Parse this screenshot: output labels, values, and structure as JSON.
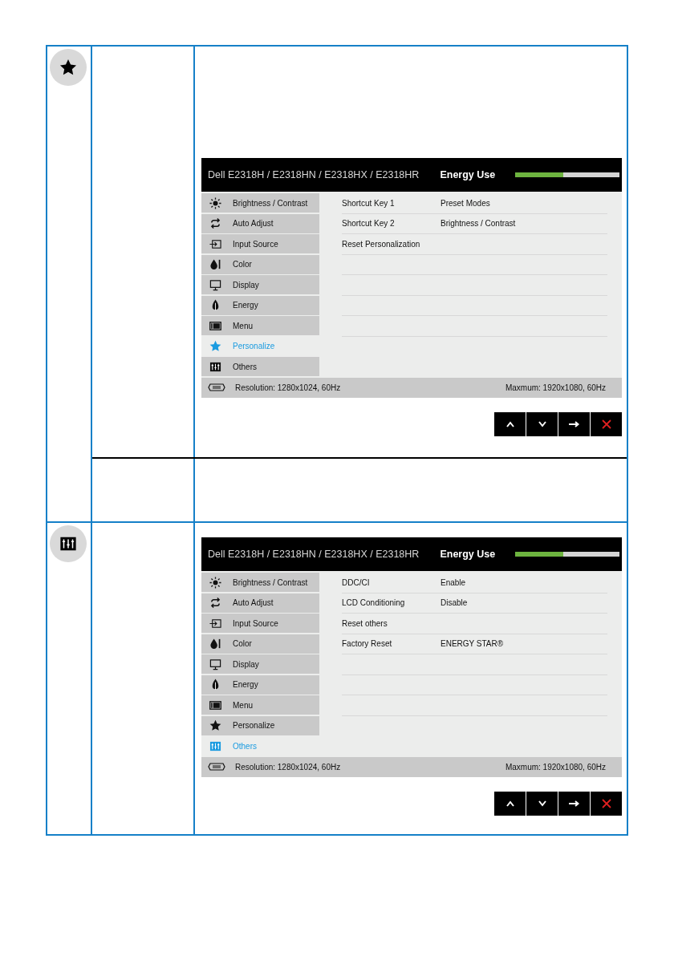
{
  "sections": [
    {
      "kind": "personalize",
      "osd": {
        "title": "Dell E2318H / E2318HN / E2318HX / E2318HR",
        "energy_label": "Energy Use",
        "energy": {
          "level": 0.46
        },
        "menu": [
          {
            "label": "Brightness / Contrast",
            "kind": "brightness",
            "selected": false
          },
          {
            "label": "Auto Adjust",
            "kind": "auto-adjust",
            "selected": false
          },
          {
            "label": "Input Source",
            "kind": "input",
            "selected": false
          },
          {
            "label": "Color",
            "kind": "color",
            "selected": false
          },
          {
            "label": "Display",
            "kind": "display",
            "selected": false
          },
          {
            "label": "Energy",
            "kind": "energy",
            "selected": false
          },
          {
            "label": "Menu",
            "kind": "menu",
            "selected": false
          },
          {
            "label": "Personalize",
            "kind": "personalize",
            "selected": true
          },
          {
            "label": "Others",
            "kind": "others",
            "selected": false
          }
        ],
        "settings": [
          {
            "label": "Shortcut Key 1",
            "value": "Preset Modes"
          },
          {
            "label": "Shortcut Key 2",
            "value": "Brightness / Contrast"
          },
          {
            "label": "Reset Personalization"
          }
        ],
        "resolution": "Resolution: 1280x1024, 60Hz",
        "maximum": "Maxmum: 1920x1080, 60Hz",
        "buttons": [
          {
            "kind": "up"
          },
          {
            "kind": "down"
          },
          {
            "kind": "right"
          },
          {
            "kind": "close"
          }
        ]
      }
    },
    {
      "kind": "others",
      "osd": {
        "title": "Dell E2318H / E2318HN / E2318HX / E2318HR",
        "energy_label": "Energy Use",
        "energy": {
          "level": 0.46
        },
        "menu": [
          {
            "label": "Brightness / Contrast",
            "kind": "brightness",
            "selected": false
          },
          {
            "label": "Auto Adjust",
            "kind": "auto-adjust",
            "selected": false
          },
          {
            "label": "Input Source",
            "kind": "input",
            "selected": false
          },
          {
            "label": "Color",
            "kind": "color",
            "selected": false
          },
          {
            "label": "Display",
            "kind": "display",
            "selected": false
          },
          {
            "label": "Energy",
            "kind": "energy",
            "selected": false
          },
          {
            "label": "Menu",
            "kind": "menu",
            "selected": false
          },
          {
            "label": "Personalize",
            "kind": "personalize",
            "selected": false
          },
          {
            "label": "Others",
            "kind": "others",
            "selected": true
          }
        ],
        "settings": [
          {
            "label": "DDC/CI",
            "value": "Enable"
          },
          {
            "label": "LCD Conditioning",
            "value": "Disable"
          },
          {
            "label": "Reset others"
          },
          {
            "label": "Factory Reset",
            "value": "ENERGY STAR®"
          }
        ],
        "resolution": "Resolution: 1280x1024, 60Hz",
        "maximum": "Maxmum: 1920x1080, 60Hz",
        "buttons": [
          {
            "kind": "up"
          },
          {
            "kind": "down"
          },
          {
            "kind": "right"
          },
          {
            "kind": "close"
          }
        ]
      }
    }
  ]
}
